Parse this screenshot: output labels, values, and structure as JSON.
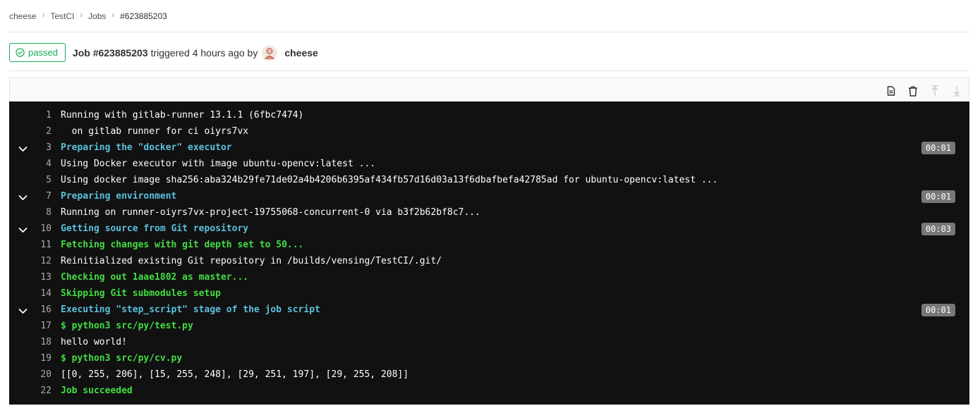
{
  "breadcrumb": {
    "items": [
      "cheese",
      "TestCI",
      "Jobs",
      "#623885203"
    ]
  },
  "job": {
    "status": "passed",
    "title": "Job #623885203",
    "triggered_text": "triggered 4 hours ago by",
    "user": "cheese"
  },
  "colors": {
    "success": "#1aaa55",
    "log_bg": "#111111",
    "section_header": "#5bc0de",
    "command_green": "#44dd44",
    "duration_badge": "#777777"
  },
  "toolbar": {
    "icons": [
      "raw-log-icon",
      "erase-log-icon",
      "scroll-top-icon",
      "scroll-bottom-icon"
    ]
  },
  "log": {
    "lines": [
      {
        "num": "1",
        "text": "Running with gitlab-runner 13.1.1 (6fbc7474)",
        "style": "white"
      },
      {
        "num": "2",
        "text": "  on gitlab runner for ci oiyrs7vx",
        "style": "white"
      },
      {
        "num": "3",
        "text": "Preparing the \"docker\" executor",
        "style": "cyan",
        "collapsible": true,
        "duration": "00:01"
      },
      {
        "num": "4",
        "text": "Using Docker executor with image ubuntu-opencv:latest ...",
        "style": "white"
      },
      {
        "num": "5",
        "text": "Using docker image sha256:aba324b29fe71de02a4b4206b6395af434fb57d16d03a13f6dbafbefa42785ad for ubuntu-opencv:latest ...",
        "style": "white"
      },
      {
        "num": "7",
        "text": "Preparing environment",
        "style": "cyan",
        "collapsible": true,
        "duration": "00:01"
      },
      {
        "num": "8",
        "text": "Running on runner-oiyrs7vx-project-19755068-concurrent-0 via b3f2b62bf8c7...",
        "style": "white"
      },
      {
        "num": "10",
        "text": "Getting source from Git repository",
        "style": "cyan",
        "collapsible": true,
        "duration": "00:03"
      },
      {
        "num": "11",
        "text": "Fetching changes with git depth set to 50...",
        "style": "green"
      },
      {
        "num": "12",
        "text": "Reinitialized existing Git repository in /builds/vensing/TestCI/.git/",
        "style": "white"
      },
      {
        "num": "13",
        "text": "Checking out 1aae1802 as master...",
        "style": "green"
      },
      {
        "num": "14",
        "text": "Skipping Git submodules setup",
        "style": "green"
      },
      {
        "num": "16",
        "text": "Executing \"step_script\" stage of the job script",
        "style": "cyan",
        "collapsible": true,
        "duration": "00:01"
      },
      {
        "num": "17",
        "text": "$ python3 src/py/test.py",
        "style": "green"
      },
      {
        "num": "18",
        "text": "hello world!",
        "style": "white"
      },
      {
        "num": "19",
        "text": "$ python3 src/py/cv.py",
        "style": "green"
      },
      {
        "num": "20",
        "text": "[[0, 255, 206], [15, 255, 248], [29, 251, 197], [29, 255, 208]]",
        "style": "white"
      },
      {
        "num": "22",
        "text": "Job succeeded",
        "style": "green"
      }
    ]
  }
}
